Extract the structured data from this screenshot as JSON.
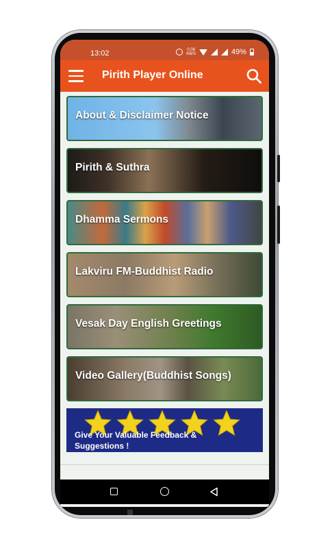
{
  "status_bar": {
    "time": "13:02",
    "speed_value": "0.08",
    "speed_unit": "KB/S",
    "battery": "49%"
  },
  "app_bar": {
    "title": "Pirith Player Online",
    "menu_icon": "hamburger-menu-icon",
    "search_icon": "search-icon"
  },
  "menu_items": [
    {
      "label": "About & Disclaimer Notice"
    },
    {
      "label": "Pirith & Suthra"
    },
    {
      "label": "Dhamma Sermons"
    },
    {
      "label": "Lakviru FM-Buddhist Radio"
    },
    {
      "label": "Vesak Day English Greetings"
    },
    {
      "label": "Video Gallery(Buddhist Songs)"
    }
  ],
  "feedback": {
    "label": "Give Your Valuable Feedback & Suggestions !",
    "stars": 5
  },
  "colors": {
    "status_bar": "#c6502a",
    "app_bar": "#e8531d",
    "card_border": "#2f6b3b",
    "feedback_bg": "#1d2b86",
    "star": "#f2d21c"
  }
}
